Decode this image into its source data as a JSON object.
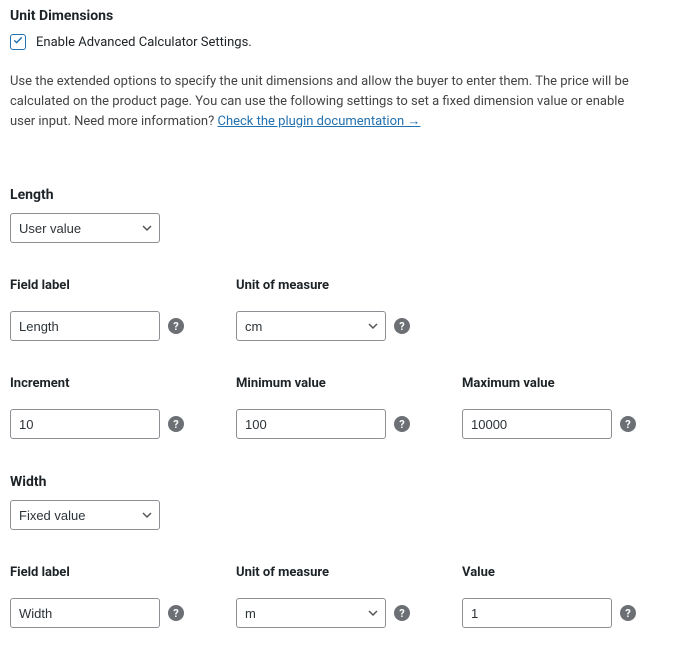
{
  "title": "Unit Dimensions",
  "enable_checkbox": {
    "label": "Enable Advanced Calculator Settings.",
    "checked": true
  },
  "description": {
    "text_before_link": "Use the extended options to specify the unit dimensions and allow the buyer to enter them. The price will be calculated on the product page. You can use the following settings to set a fixed dimension value or enable user input. Need more information? ",
    "link_text": "Check the plugin documentation →"
  },
  "length": {
    "header": "Length",
    "type_value": "User value",
    "field_label": {
      "label": "Field label",
      "value": "Length"
    },
    "unit": {
      "label": "Unit of measure",
      "value": "cm"
    },
    "increment": {
      "label": "Increment",
      "value": "10"
    },
    "minimum": {
      "label": "Minimum value",
      "value": "100"
    },
    "maximum": {
      "label": "Maximum value",
      "value": "10000"
    }
  },
  "width": {
    "header": "Width",
    "type_value": "Fixed value",
    "field_label": {
      "label": "Field label",
      "value": "Width"
    },
    "unit": {
      "label": "Unit of measure",
      "value": "m"
    },
    "value": {
      "label": "Value",
      "value": "1"
    }
  }
}
